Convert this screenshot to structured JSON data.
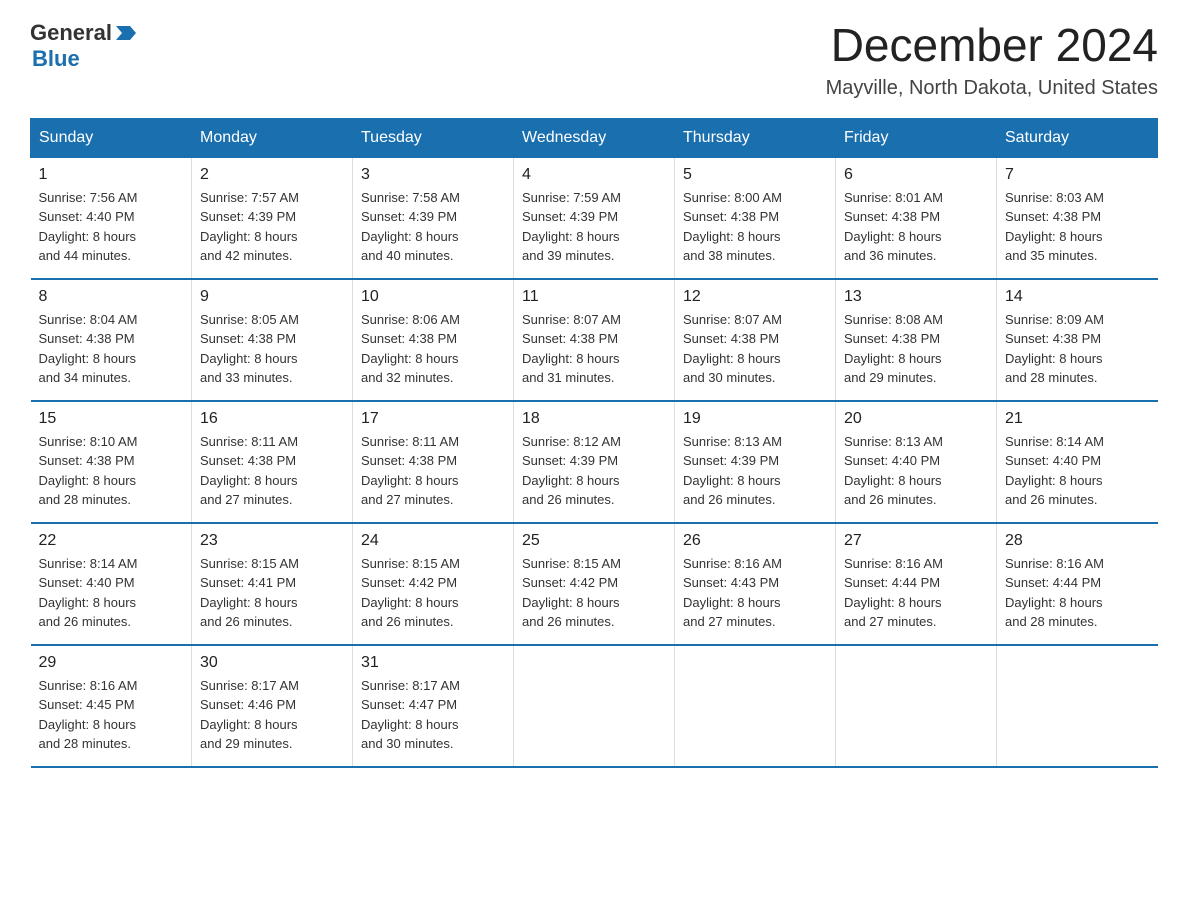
{
  "header": {
    "logo_general": "General",
    "logo_blue": "Blue",
    "title": "December 2024",
    "subtitle": "Mayville, North Dakota, United States"
  },
  "days_of_week": [
    "Sunday",
    "Monday",
    "Tuesday",
    "Wednesday",
    "Thursday",
    "Friday",
    "Saturday"
  ],
  "weeks": [
    [
      {
        "day": "1",
        "sunrise": "7:56 AM",
        "sunset": "4:40 PM",
        "daylight": "8 hours and 44 minutes."
      },
      {
        "day": "2",
        "sunrise": "7:57 AM",
        "sunset": "4:39 PM",
        "daylight": "8 hours and 42 minutes."
      },
      {
        "day": "3",
        "sunrise": "7:58 AM",
        "sunset": "4:39 PM",
        "daylight": "8 hours and 40 minutes."
      },
      {
        "day": "4",
        "sunrise": "7:59 AM",
        "sunset": "4:39 PM",
        "daylight": "8 hours and 39 minutes."
      },
      {
        "day": "5",
        "sunrise": "8:00 AM",
        "sunset": "4:38 PM",
        "daylight": "8 hours and 38 minutes."
      },
      {
        "day": "6",
        "sunrise": "8:01 AM",
        "sunset": "4:38 PM",
        "daylight": "8 hours and 36 minutes."
      },
      {
        "day": "7",
        "sunrise": "8:03 AM",
        "sunset": "4:38 PM",
        "daylight": "8 hours and 35 minutes."
      }
    ],
    [
      {
        "day": "8",
        "sunrise": "8:04 AM",
        "sunset": "4:38 PM",
        "daylight": "8 hours and 34 minutes."
      },
      {
        "day": "9",
        "sunrise": "8:05 AM",
        "sunset": "4:38 PM",
        "daylight": "8 hours and 33 minutes."
      },
      {
        "day": "10",
        "sunrise": "8:06 AM",
        "sunset": "4:38 PM",
        "daylight": "8 hours and 32 minutes."
      },
      {
        "day": "11",
        "sunrise": "8:07 AM",
        "sunset": "4:38 PM",
        "daylight": "8 hours and 31 minutes."
      },
      {
        "day": "12",
        "sunrise": "8:07 AM",
        "sunset": "4:38 PM",
        "daylight": "8 hours and 30 minutes."
      },
      {
        "day": "13",
        "sunrise": "8:08 AM",
        "sunset": "4:38 PM",
        "daylight": "8 hours and 29 minutes."
      },
      {
        "day": "14",
        "sunrise": "8:09 AM",
        "sunset": "4:38 PM",
        "daylight": "8 hours and 28 minutes."
      }
    ],
    [
      {
        "day": "15",
        "sunrise": "8:10 AM",
        "sunset": "4:38 PM",
        "daylight": "8 hours and 28 minutes."
      },
      {
        "day": "16",
        "sunrise": "8:11 AM",
        "sunset": "4:38 PM",
        "daylight": "8 hours and 27 minutes."
      },
      {
        "day": "17",
        "sunrise": "8:11 AM",
        "sunset": "4:38 PM",
        "daylight": "8 hours and 27 minutes."
      },
      {
        "day": "18",
        "sunrise": "8:12 AM",
        "sunset": "4:39 PM",
        "daylight": "8 hours and 26 minutes."
      },
      {
        "day": "19",
        "sunrise": "8:13 AM",
        "sunset": "4:39 PM",
        "daylight": "8 hours and 26 minutes."
      },
      {
        "day": "20",
        "sunrise": "8:13 AM",
        "sunset": "4:40 PM",
        "daylight": "8 hours and 26 minutes."
      },
      {
        "day": "21",
        "sunrise": "8:14 AM",
        "sunset": "4:40 PM",
        "daylight": "8 hours and 26 minutes."
      }
    ],
    [
      {
        "day": "22",
        "sunrise": "8:14 AM",
        "sunset": "4:40 PM",
        "daylight": "8 hours and 26 minutes."
      },
      {
        "day": "23",
        "sunrise": "8:15 AM",
        "sunset": "4:41 PM",
        "daylight": "8 hours and 26 minutes."
      },
      {
        "day": "24",
        "sunrise": "8:15 AM",
        "sunset": "4:42 PM",
        "daylight": "8 hours and 26 minutes."
      },
      {
        "day": "25",
        "sunrise": "8:15 AM",
        "sunset": "4:42 PM",
        "daylight": "8 hours and 26 minutes."
      },
      {
        "day": "26",
        "sunrise": "8:16 AM",
        "sunset": "4:43 PM",
        "daylight": "8 hours and 27 minutes."
      },
      {
        "day": "27",
        "sunrise": "8:16 AM",
        "sunset": "4:44 PM",
        "daylight": "8 hours and 27 minutes."
      },
      {
        "day": "28",
        "sunrise": "8:16 AM",
        "sunset": "4:44 PM",
        "daylight": "8 hours and 28 minutes."
      }
    ],
    [
      {
        "day": "29",
        "sunrise": "8:16 AM",
        "sunset": "4:45 PM",
        "daylight": "8 hours and 28 minutes."
      },
      {
        "day": "30",
        "sunrise": "8:17 AM",
        "sunset": "4:46 PM",
        "daylight": "8 hours and 29 minutes."
      },
      {
        "day": "31",
        "sunrise": "8:17 AM",
        "sunset": "4:47 PM",
        "daylight": "8 hours and 30 minutes."
      },
      null,
      null,
      null,
      null
    ]
  ],
  "labels": {
    "sunrise": "Sunrise:",
    "sunset": "Sunset:",
    "daylight": "Daylight:"
  }
}
